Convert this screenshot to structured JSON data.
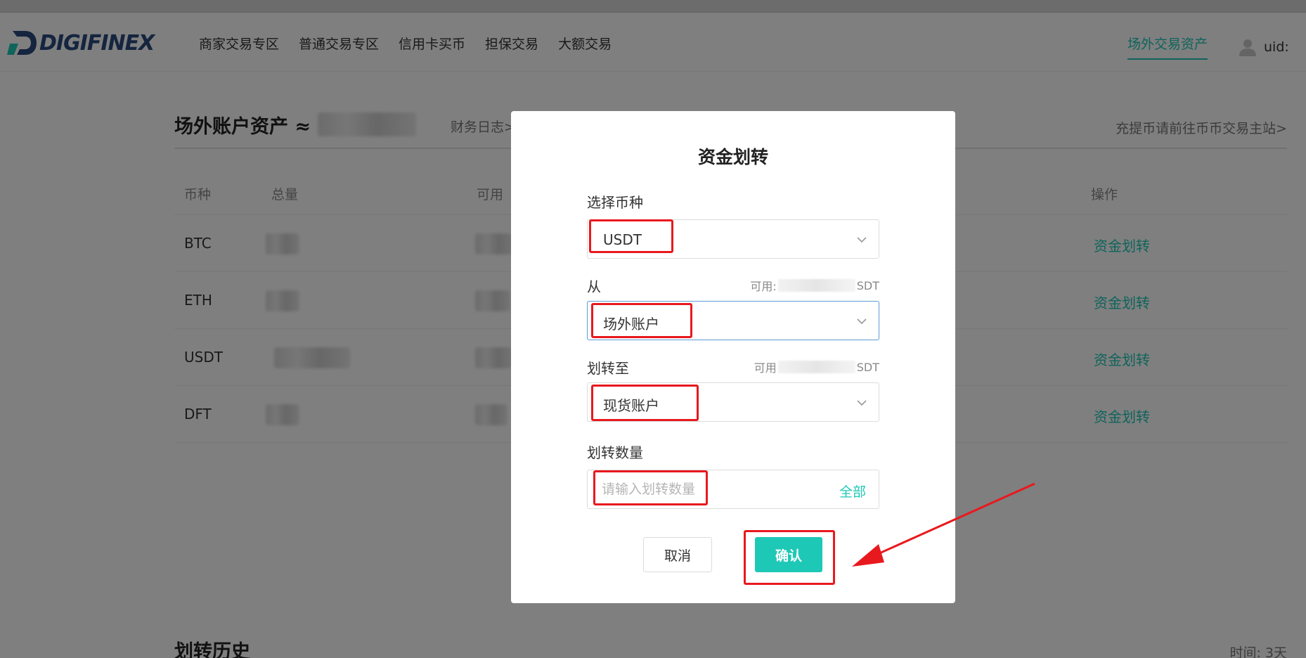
{
  "header": {
    "logo_text": "DIGIFINEX",
    "nav": [
      "商家交易专区",
      "普通交易专区",
      "信用卡买币",
      "担保交易",
      "大额交易"
    ],
    "active_nav": "场外交易资产",
    "uid_label": "uid:"
  },
  "page": {
    "title": "场外账户资产 ≈",
    "finance_log": "财务日志>",
    "deposit_link": "充提币请前往币币交易主站>",
    "table": {
      "headers": [
        "币种",
        "总量",
        "可用",
        "操作"
      ],
      "rows": [
        {
          "symbol": "BTC",
          "action": "资金划转"
        },
        {
          "symbol": "ETH",
          "action": "资金划转"
        },
        {
          "symbol": "USDT",
          "action": "资金划转"
        },
        {
          "symbol": "DFT",
          "action": "资金划转"
        }
      ]
    },
    "history_title": "划转历史",
    "time_filter": "时间: 3天"
  },
  "modal": {
    "title": "资金划转",
    "coin_label": "选择币种",
    "coin_value": "USDT",
    "from_label": "从",
    "from_avail_prefix": "可用:",
    "from_avail_suffix": "SDT",
    "from_value": "场外账户",
    "to_label": "划转至",
    "to_avail_prefix": "可用",
    "to_avail_suffix": "SDT",
    "to_value": "现货账户",
    "amount_label": "划转数量",
    "amount_placeholder": "请输入划转数量",
    "amount_all": "全部",
    "cancel": "取消",
    "confirm": "确认"
  },
  "colors": {
    "accent": "#1ec8b6",
    "annotation": "#e8191e",
    "overlay": "rgba(0,0,0,0.5)"
  }
}
